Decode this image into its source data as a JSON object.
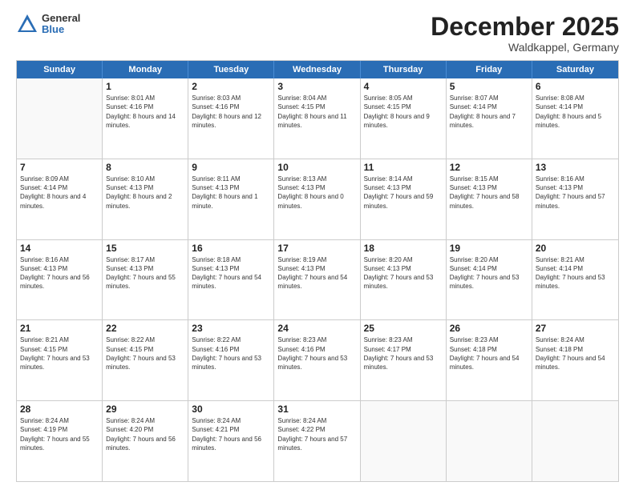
{
  "logo": {
    "general": "General",
    "blue": "Blue"
  },
  "title": {
    "month": "December 2025",
    "location": "Waldkappel, Germany"
  },
  "weekdays": [
    "Sunday",
    "Monday",
    "Tuesday",
    "Wednesday",
    "Thursday",
    "Friday",
    "Saturday"
  ],
  "weeks": [
    [
      {
        "day": "",
        "sunrise": "",
        "sunset": "",
        "daylight": ""
      },
      {
        "day": "1",
        "sunrise": "Sunrise: 8:01 AM",
        "sunset": "Sunset: 4:16 PM",
        "daylight": "Daylight: 8 hours and 14 minutes."
      },
      {
        "day": "2",
        "sunrise": "Sunrise: 8:03 AM",
        "sunset": "Sunset: 4:16 PM",
        "daylight": "Daylight: 8 hours and 12 minutes."
      },
      {
        "day": "3",
        "sunrise": "Sunrise: 8:04 AM",
        "sunset": "Sunset: 4:15 PM",
        "daylight": "Daylight: 8 hours and 11 minutes."
      },
      {
        "day": "4",
        "sunrise": "Sunrise: 8:05 AM",
        "sunset": "Sunset: 4:15 PM",
        "daylight": "Daylight: 8 hours and 9 minutes."
      },
      {
        "day": "5",
        "sunrise": "Sunrise: 8:07 AM",
        "sunset": "Sunset: 4:14 PM",
        "daylight": "Daylight: 8 hours and 7 minutes."
      },
      {
        "day": "6",
        "sunrise": "Sunrise: 8:08 AM",
        "sunset": "Sunset: 4:14 PM",
        "daylight": "Daylight: 8 hours and 5 minutes."
      }
    ],
    [
      {
        "day": "7",
        "sunrise": "Sunrise: 8:09 AM",
        "sunset": "Sunset: 4:14 PM",
        "daylight": "Daylight: 8 hours and 4 minutes."
      },
      {
        "day": "8",
        "sunrise": "Sunrise: 8:10 AM",
        "sunset": "Sunset: 4:13 PM",
        "daylight": "Daylight: 8 hours and 2 minutes."
      },
      {
        "day": "9",
        "sunrise": "Sunrise: 8:11 AM",
        "sunset": "Sunset: 4:13 PM",
        "daylight": "Daylight: 8 hours and 1 minute."
      },
      {
        "day": "10",
        "sunrise": "Sunrise: 8:13 AM",
        "sunset": "Sunset: 4:13 PM",
        "daylight": "Daylight: 8 hours and 0 minutes."
      },
      {
        "day": "11",
        "sunrise": "Sunrise: 8:14 AM",
        "sunset": "Sunset: 4:13 PM",
        "daylight": "Daylight: 7 hours and 59 minutes."
      },
      {
        "day": "12",
        "sunrise": "Sunrise: 8:15 AM",
        "sunset": "Sunset: 4:13 PM",
        "daylight": "Daylight: 7 hours and 58 minutes."
      },
      {
        "day": "13",
        "sunrise": "Sunrise: 8:16 AM",
        "sunset": "Sunset: 4:13 PM",
        "daylight": "Daylight: 7 hours and 57 minutes."
      }
    ],
    [
      {
        "day": "14",
        "sunrise": "Sunrise: 8:16 AM",
        "sunset": "Sunset: 4:13 PM",
        "daylight": "Daylight: 7 hours and 56 minutes."
      },
      {
        "day": "15",
        "sunrise": "Sunrise: 8:17 AM",
        "sunset": "Sunset: 4:13 PM",
        "daylight": "Daylight: 7 hours and 55 minutes."
      },
      {
        "day": "16",
        "sunrise": "Sunrise: 8:18 AM",
        "sunset": "Sunset: 4:13 PM",
        "daylight": "Daylight: 7 hours and 54 minutes."
      },
      {
        "day": "17",
        "sunrise": "Sunrise: 8:19 AM",
        "sunset": "Sunset: 4:13 PM",
        "daylight": "Daylight: 7 hours and 54 minutes."
      },
      {
        "day": "18",
        "sunrise": "Sunrise: 8:20 AM",
        "sunset": "Sunset: 4:13 PM",
        "daylight": "Daylight: 7 hours and 53 minutes."
      },
      {
        "day": "19",
        "sunrise": "Sunrise: 8:20 AM",
        "sunset": "Sunset: 4:14 PM",
        "daylight": "Daylight: 7 hours and 53 minutes."
      },
      {
        "day": "20",
        "sunrise": "Sunrise: 8:21 AM",
        "sunset": "Sunset: 4:14 PM",
        "daylight": "Daylight: 7 hours and 53 minutes."
      }
    ],
    [
      {
        "day": "21",
        "sunrise": "Sunrise: 8:21 AM",
        "sunset": "Sunset: 4:15 PM",
        "daylight": "Daylight: 7 hours and 53 minutes."
      },
      {
        "day": "22",
        "sunrise": "Sunrise: 8:22 AM",
        "sunset": "Sunset: 4:15 PM",
        "daylight": "Daylight: 7 hours and 53 minutes."
      },
      {
        "day": "23",
        "sunrise": "Sunrise: 8:22 AM",
        "sunset": "Sunset: 4:16 PM",
        "daylight": "Daylight: 7 hours and 53 minutes."
      },
      {
        "day": "24",
        "sunrise": "Sunrise: 8:23 AM",
        "sunset": "Sunset: 4:16 PM",
        "daylight": "Daylight: 7 hours and 53 minutes."
      },
      {
        "day": "25",
        "sunrise": "Sunrise: 8:23 AM",
        "sunset": "Sunset: 4:17 PM",
        "daylight": "Daylight: 7 hours and 53 minutes."
      },
      {
        "day": "26",
        "sunrise": "Sunrise: 8:23 AM",
        "sunset": "Sunset: 4:18 PM",
        "daylight": "Daylight: 7 hours and 54 minutes."
      },
      {
        "day": "27",
        "sunrise": "Sunrise: 8:24 AM",
        "sunset": "Sunset: 4:18 PM",
        "daylight": "Daylight: 7 hours and 54 minutes."
      }
    ],
    [
      {
        "day": "28",
        "sunrise": "Sunrise: 8:24 AM",
        "sunset": "Sunset: 4:19 PM",
        "daylight": "Daylight: 7 hours and 55 minutes."
      },
      {
        "day": "29",
        "sunrise": "Sunrise: 8:24 AM",
        "sunset": "Sunset: 4:20 PM",
        "daylight": "Daylight: 7 hours and 56 minutes."
      },
      {
        "day": "30",
        "sunrise": "Sunrise: 8:24 AM",
        "sunset": "Sunset: 4:21 PM",
        "daylight": "Daylight: 7 hours and 56 minutes."
      },
      {
        "day": "31",
        "sunrise": "Sunrise: 8:24 AM",
        "sunset": "Sunset: 4:22 PM",
        "daylight": "Daylight: 7 hours and 57 minutes."
      },
      {
        "day": "",
        "sunrise": "",
        "sunset": "",
        "daylight": ""
      },
      {
        "day": "",
        "sunrise": "",
        "sunset": "",
        "daylight": ""
      },
      {
        "day": "",
        "sunrise": "",
        "sunset": "",
        "daylight": ""
      }
    ]
  ]
}
